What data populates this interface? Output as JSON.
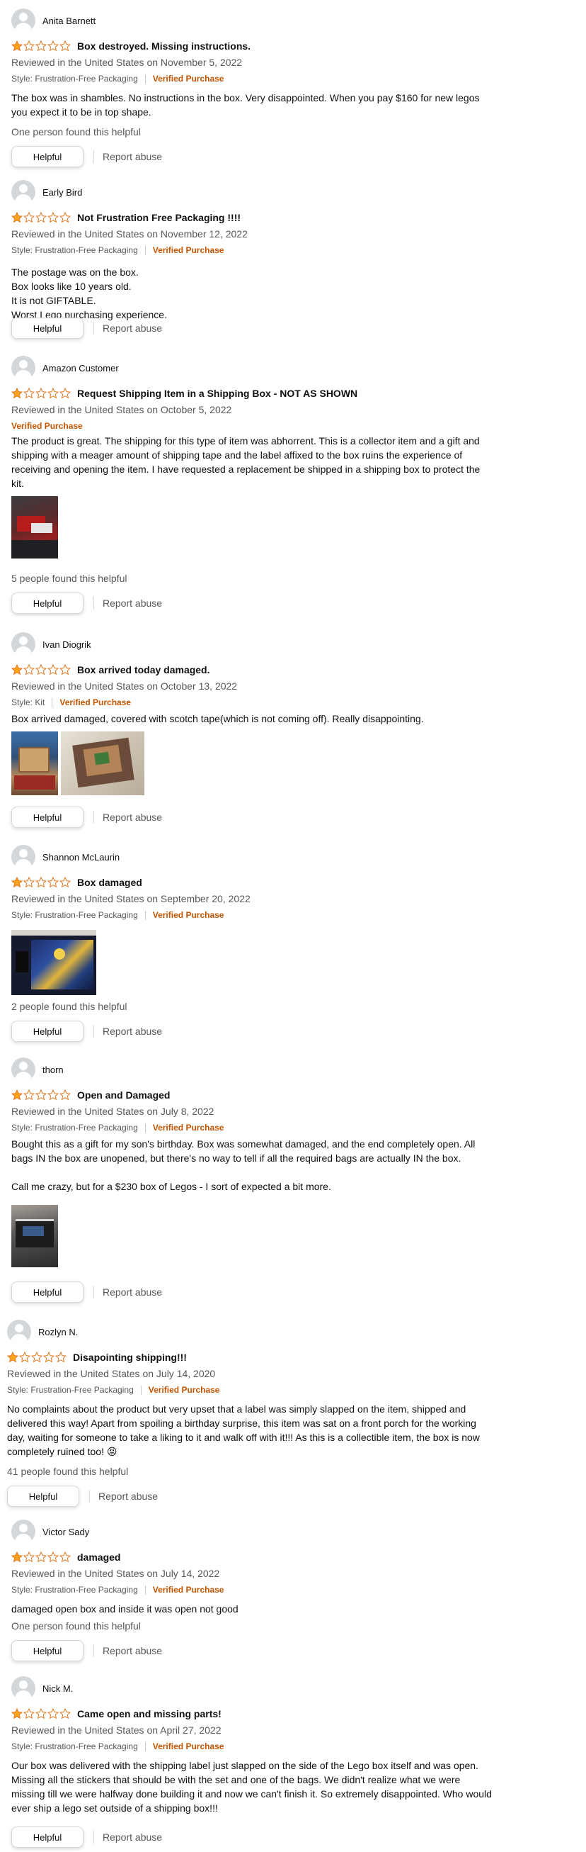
{
  "colors": {
    "star": "#ffa41c",
    "star_outline": "#de7921",
    "verified": "#c45500",
    "text": "#0f1111",
    "muted": "#565959",
    "button_border": "#d5d9d9"
  },
  "icons": {
    "star": "star-icon",
    "avatar": "default-user-avatar-icon"
  },
  "helpful_label": "Helpful",
  "report_label": "Report abuse",
  "reviews": [
    {
      "name": "Anita Barnett",
      "rating": 1,
      "title": "Box destroyed. Missing instructions.",
      "date": "Reviewed in the United States on November 5, 2022",
      "style": "Style: Frustration-Free Packaging",
      "verified": "Verified Purchase",
      "body": [
        "The box was in shambles. No instructions in the box. Very disappointed. When you pay $160 for new legos you expect it to be in top shape."
      ],
      "helpful_text": "One person found this helpful"
    },
    {
      "name": "Early Bird",
      "rating": 1,
      "title": "Not Frustration Free Packaging !!!!",
      "date": "Reviewed in the United States on November 12, 2022",
      "style": "Style: Frustration-Free Packaging",
      "verified": "Verified Purchase",
      "body": [
        "The postage was on the box.",
        "Box looks like 10 years old.",
        "It is not GIFTABLE.",
        "Worst Lego purchasing experience."
      ],
      "helpful_text": ""
    },
    {
      "name": "Amazon Customer",
      "rating": 1,
      "title": "Request Shipping Item in a Shipping Box - NOT AS SHOWN",
      "date": "Reviewed in the United States on October 5, 2022",
      "style": "",
      "verified": "Verified Purchase",
      "body": [
        "The product is great. The shipping for this type of item was abhorrent. This is a collector item and a gift and shipping with a meager amount of shipping tape and the label affixed to the box ruins the experience of receiving and opening the item. I have requested a replacement be shipped in a shipping box to protect the kit."
      ],
      "helpful_text": "5 people found this helpful"
    },
    {
      "name": "Ivan Diogrik",
      "rating": 1,
      "title": "Box arrived today damaged.",
      "date": "Reviewed in the United States on October 13, 2022",
      "style": "Style: Kit",
      "verified": "Verified Purchase",
      "body": [
        "Box arrived damaged, covered with scotch tape(which is not coming off). Really disappointing."
      ],
      "helpful_text": ""
    },
    {
      "name": "Shannon McLaurin",
      "rating": 1,
      "title": "Box damaged",
      "date": "Reviewed in the United States on September 20, 2022",
      "style": "Style: Frustration-Free Packaging",
      "verified": "Verified Purchase",
      "body": [],
      "helpful_text": "2 people found this helpful"
    },
    {
      "name": "thorn",
      "rating": 1,
      "title": "Open and Damaged",
      "date": "Reviewed in the United States on July 8, 2022",
      "style": "Style: Frustration-Free Packaging",
      "verified": "Verified Purchase",
      "body": [
        "Bought this as a gift for my son's birthday. Box was somewhat damaged, and the end completely open. All bags IN the box are unopened, but there's no way to tell if all the required bags are actually IN the box.",
        "",
        "Call me crazy, but for a $230 box of Legos - I sort of expected a bit more."
      ],
      "helpful_text": ""
    },
    {
      "name": "Rozlyn N.",
      "rating": 1,
      "title": "Disapointing shipping!!!",
      "date": "Reviewed in the United States on July 14, 2020",
      "style": "Style: Frustration-Free Packaging",
      "verified": "Verified Purchase",
      "body": [
        "No complaints about the product but very upset that a label was simply slapped on the item, shipped and delivered this way! Apart from spoiling a birthday surprise, this item was sat on a front porch for the working day, waiting for someone to take a liking to it and walk off with it!!! As this is a collectible item, the box is now completely ruined too! 😡"
      ],
      "helpful_text": "41 people found this helpful"
    },
    {
      "name": "Victor Sady",
      "rating": 1,
      "title": "damaged",
      "date": "Reviewed in the United States on July 14, 2022",
      "style": "Style: Frustration-Free Packaging",
      "verified": "Verified Purchase",
      "body": [
        "damaged open box and inside it was open not good"
      ],
      "helpful_text": "One person found this helpful"
    },
    {
      "name": "Nick M.",
      "rating": 1,
      "title": "Came open and missing parts!",
      "date": "Reviewed in the United States on April 27, 2022",
      "style": "Style: Frustration-Free Packaging",
      "verified": "Verified Purchase",
      "body": [
        "Our box was delivered with the shipping label just slapped on the side of the Lego box itself and was open. Missing all the stickers that should be with the set and one of the bags. We didn't realize what we were missing till we were halfway done building it and now we can't finish it. So extremely disappointed. Who would ever ship a lego set outside of a shipping box!!!"
      ],
      "helpful_text": ""
    }
  ]
}
